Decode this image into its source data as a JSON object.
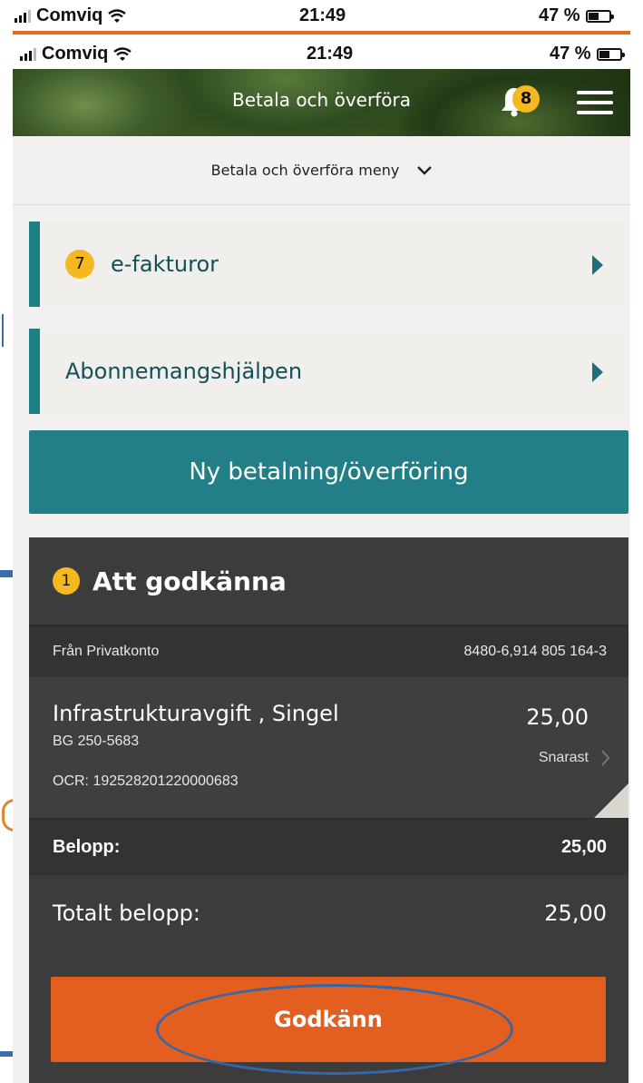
{
  "status_bar": {
    "carrier": "Comviq",
    "time": "21:49",
    "battery": "47 %"
  },
  "header": {
    "title": "Betala och överföra",
    "notification_count": "8"
  },
  "submenu": {
    "label": "Betala och överföra meny"
  },
  "nav_cards": [
    {
      "badge": "7",
      "label": "e-fakturor"
    },
    {
      "label": "Abonnemangshjälpen"
    }
  ],
  "new_payment_button": "Ny betalning/överföring",
  "approval": {
    "badge": "1",
    "title": "Att godkänna",
    "from_label": "Från Privatkonto",
    "from_account": "8480-6,914 805 164-3",
    "payment": {
      "payee": "Infrastrukturavgift , Singel",
      "amount": "25,00",
      "bankgiro": "BG 250-5683",
      "when": "Snarast",
      "ocr": "OCR: 192528201220000683"
    },
    "sum_label": "Belopp:",
    "sum_value": "25,00",
    "total_label": "Totalt belopp:",
    "total_value": "25,00",
    "approve_button": "Godkänn"
  },
  "colors": {
    "accent_teal": "#227e87",
    "approve_orange": "#e35f20",
    "badge_yellow": "#f5b820",
    "panel_dark": "#3c3c3c",
    "annotation_blue": "#3566a6"
  },
  "icons": [
    "signal-icon",
    "wifi-icon",
    "battery-icon",
    "bell-icon",
    "menu-icon",
    "chevron-down-icon",
    "chevron-right-icon"
  ]
}
